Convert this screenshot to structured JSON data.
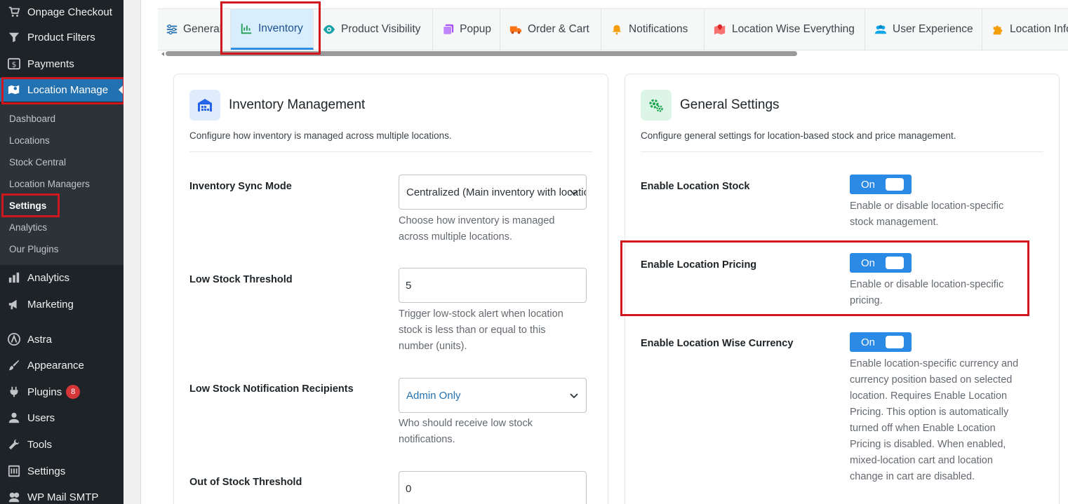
{
  "sidebar": {
    "items": [
      {
        "label": "Onpage Checkout",
        "icon": "cart-icon"
      },
      {
        "label": "Product Filters",
        "icon": "filter-icon"
      },
      {
        "label": "Payments",
        "icon": "dollar-icon"
      },
      {
        "label": "Location Manage",
        "icon": "map-icon"
      },
      {
        "label": "Analytics",
        "icon": "bar-chart-icon"
      },
      {
        "label": "Marketing",
        "icon": "megaphone-icon"
      },
      {
        "label": "Astra",
        "icon": "astra-icon"
      },
      {
        "label": "Appearance",
        "icon": "brush-icon"
      },
      {
        "label": "Plugins",
        "icon": "plug-icon",
        "badge": "8"
      },
      {
        "label": "Users",
        "icon": "user-icon"
      },
      {
        "label": "Tools",
        "icon": "wrench-icon"
      },
      {
        "label": "Settings",
        "icon": "settings-icon"
      },
      {
        "label": "WP Mail SMTP",
        "icon": "mail-icon"
      }
    ],
    "submenu": [
      "Dashboard",
      "Locations",
      "Stock Central",
      "Location Managers",
      "Settings",
      "Analytics",
      "Our Plugins"
    ]
  },
  "tabs": [
    {
      "label": "General"
    },
    {
      "label": "Inventory"
    },
    {
      "label": "Product Visibility"
    },
    {
      "label": "Popup"
    },
    {
      "label": "Order & Cart"
    },
    {
      "label": "Notifications"
    },
    {
      "label": "Location Wise Everything"
    },
    {
      "label": "User Experience"
    },
    {
      "label": "Location Info"
    }
  ],
  "inventory": {
    "title": "Inventory Management",
    "description": "Configure how inventory is managed across multiple locations.",
    "sync_mode": {
      "label": "Inventory Sync Mode",
      "value": "Centralized (Main inventory with location",
      "help1": "Choose how inventory is managed",
      "help2": "across multiple locations."
    },
    "low_stock": {
      "label": "Low Stock Threshold",
      "value": "5",
      "help1": "Trigger low-stock alert when location",
      "help2": "stock is less than or equal to this",
      "help3": "number (units)."
    },
    "recipients": {
      "label": "Low Stock Notification Recipients",
      "value": "Admin Only",
      "help1": "Who should receive low stock",
      "help2": "notifications."
    },
    "out_of_stock": {
      "label": "Out of Stock Threshold",
      "value": "0"
    }
  },
  "general": {
    "title": "General Settings",
    "description": "Configure general settings for location-based stock and price management.",
    "location_stock": {
      "label": "Enable Location Stock",
      "toggle": "On",
      "help1": "Enable or disable location-specific",
      "help2": "stock management."
    },
    "location_pricing": {
      "label": "Enable Location Pricing",
      "toggle": "On",
      "help1": "Enable or disable location-specific",
      "help2": "pricing."
    },
    "location_currency": {
      "label": "Enable Location Wise Currency",
      "toggle": "On",
      "help": [
        "Enable location-specific currency and",
        "currency position based on selected",
        "location. Requires Enable Location",
        "Pricing. This option is automatically",
        "turned off when Enable Location",
        "Pricing is disabled. When enabled,",
        "mixed-location cart and location",
        "change in cart are disabled."
      ]
    }
  },
  "colors": {
    "sidebar_bg": "#1d2327",
    "active_menu": "#2271b1",
    "toggle_on": "#2b8ae6",
    "highlight": "#d0161e"
  }
}
